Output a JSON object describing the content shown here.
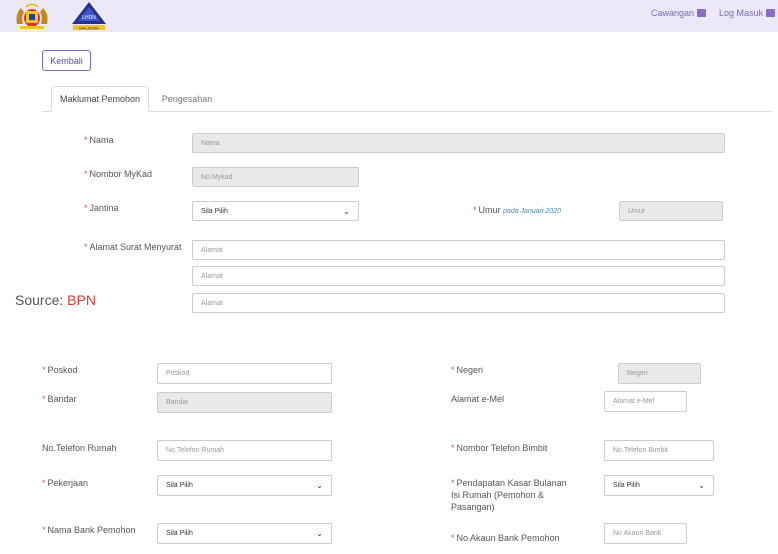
{
  "header": {
    "cawangan": "Cawangan",
    "log_masuk": "Log Masuk",
    "lhdn_logo_text": "LHDN",
    "malaysia_text": "MALAYSIA"
  },
  "back_label": "Kembali",
  "tabs": [
    "Maklumat Pemohon",
    "Pengesahan"
  ],
  "form": {
    "nama": {
      "label": "Nama",
      "placeholder": "Nama"
    },
    "mykad": {
      "label": "Nombor MyKad",
      "placeholder": "No.Mykad"
    },
    "jantina": {
      "label": "Jantina",
      "selected": "Sila Pilih"
    },
    "umur": {
      "label": "Umur",
      "sub": "pada Januari 2020",
      "placeholder": "Umur"
    },
    "alamat": {
      "label": "Alamat Surat Menyurat",
      "placeholders": [
        "Alamat",
        "Alamat",
        "Alamat"
      ]
    },
    "poskod": {
      "label": "Poskod",
      "placeholder": "Poskod"
    },
    "negeri": {
      "label": "Negeri",
      "placeholder": "Negeri"
    },
    "bandar": {
      "label": "Bandar",
      "placeholder": "Bandar"
    },
    "emel": {
      "label": "Alamat e-Mel",
      "placeholder": "Alamat e-Mel"
    },
    "tel_rumah": {
      "label": "No.Telefon Rumah",
      "placeholder": "No.Telefon Rumah"
    },
    "tel_bimbit": {
      "label": "Nombor Telefon Bimbit",
      "placeholder": "No.Telefon Bimbit"
    },
    "pekerjaan": {
      "label": "Pekerjaan",
      "selected": "Sila Pilih"
    },
    "pendapatan": {
      "label_lines": [
        "Pendapatan Kasar Bulanan",
        "Isi Rumah (Pemohon &",
        "Pasangan)"
      ],
      "selected": "Sila Pilih"
    },
    "bank": {
      "label": "Nama Bank Pemohon",
      "selected": "Sila Pilih"
    },
    "akaun": {
      "label": "No Akaun Bank Pemohon",
      "placeholder": "No Akaun Bank"
    }
  },
  "source": {
    "prefix": "Source:",
    "brand": "BPN"
  },
  "colors": {
    "topbar": "#ece8f7",
    "accent": "#7b68c8",
    "required": "#d9534f"
  }
}
